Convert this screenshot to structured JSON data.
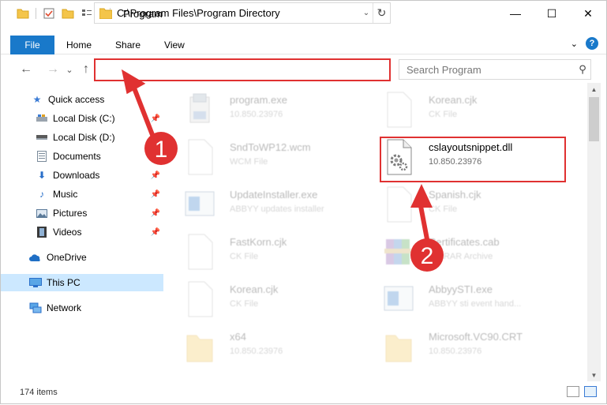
{
  "window": {
    "title": "Program",
    "controls": {
      "minimize": "—",
      "maximize": "☐",
      "close": "✕"
    }
  },
  "ribbon": {
    "tabs": [
      "File",
      "Home",
      "Share",
      "View"
    ],
    "help": "?",
    "expand": "⌄"
  },
  "nav": {
    "back": "←",
    "forward": "→",
    "recent": "⌄",
    "up": "↑",
    "address": "C:\\Program Files\\Program Directory",
    "search_placeholder": "Search Program"
  },
  "sidebar": {
    "items": [
      {
        "label": "Quick access",
        "icon": "star-icon",
        "pinned": false
      },
      {
        "label": "Local Disk (C:)",
        "icon": "drive-icon",
        "pinned": true
      },
      {
        "label": "Local Disk (D:)",
        "icon": "drive-icon",
        "pinned": false
      },
      {
        "label": "Documents",
        "icon": "documents-icon",
        "pinned": true
      },
      {
        "label": "Downloads",
        "icon": "downloads-icon",
        "pinned": true
      },
      {
        "label": "Music",
        "icon": "music-icon",
        "pinned": true
      },
      {
        "label": "Pictures",
        "icon": "pictures-icon",
        "pinned": true
      },
      {
        "label": "Videos",
        "icon": "videos-icon",
        "pinned": true
      },
      {
        "label": "OneDrive",
        "icon": "cloud-icon",
        "pinned": false
      },
      {
        "label": "This PC",
        "icon": "computer-icon",
        "pinned": false,
        "selected": true
      },
      {
        "label": "Network",
        "icon": "network-icon",
        "pinned": false
      }
    ]
  },
  "files": [
    {
      "name": "program.exe",
      "sub": "10.850.23976",
      "icon": "installer-icon"
    },
    {
      "name": "Korean.cjk",
      "sub": "CK File",
      "icon": "blank-file-icon"
    },
    {
      "name": "SndToWP12.wcm",
      "sub": "WCM File",
      "icon": "blank-file-icon"
    },
    {
      "name": "cslayoutsnippet.dll",
      "sub": "10.850.23976",
      "icon": "dll-gear-icon",
      "highlight": true
    },
    {
      "name": "UpdateInstaller.exe",
      "sub": "ABBYY updates installer",
      "icon": "app-window-icon"
    },
    {
      "name": "Spanish.cjk",
      "sub": "CK File",
      "icon": "blank-file-icon"
    },
    {
      "name": "FastKorn.cjk",
      "sub": "CK File",
      "icon": "blank-file-icon"
    },
    {
      "name": "Certificates.cab",
      "sub": "WinRAR Archive",
      "icon": "archive-icon"
    },
    {
      "name": "Korean.cjk",
      "sub": "CK File",
      "icon": "blank-file-icon"
    },
    {
      "name": "AbbyySTI.exe",
      "sub": "ABBYY sti event hand...",
      "icon": "app-window-icon"
    },
    {
      "name": "x64",
      "sub": "10.850.23976",
      "icon": "folder-icon"
    },
    {
      "name": "Microsoft.VC90.CRT",
      "sub": "10.850.23976",
      "icon": "folder-icon"
    }
  ],
  "status": {
    "count": "174 items"
  },
  "annotations": {
    "step1": "1",
    "step2": "2",
    "color": "#e03131"
  },
  "colors": {
    "accent": "#1979ca",
    "selected": "#cce8ff"
  }
}
